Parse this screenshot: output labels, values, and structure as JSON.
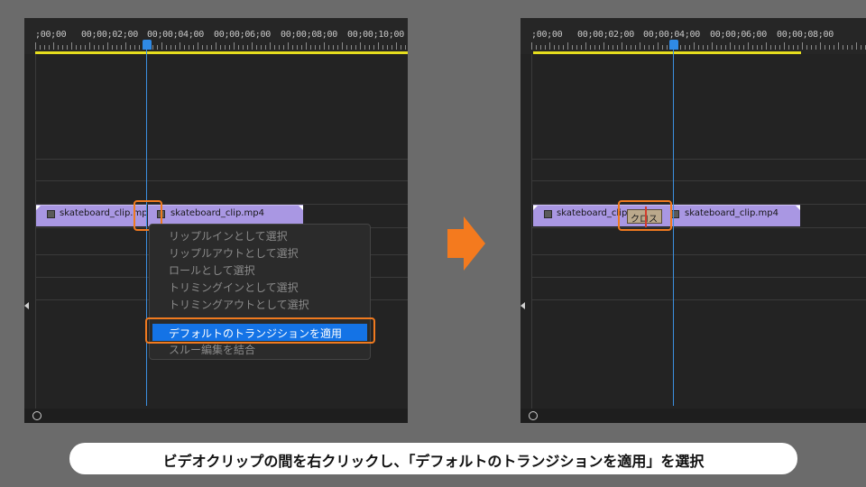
{
  "left_panel": {
    "timecodes": [
      ";00;00",
      "00;00;02;00",
      "00;00;04;00",
      "00;00;06;00",
      "00;00;08;00",
      "00;00;10;00"
    ],
    "clips": [
      {
        "label": "skateboard_clip.mp4",
        "display": "skateboard_clip.mp"
      },
      {
        "label": "skateboard_clip.mp4",
        "display": "skateboard_clip.mp4"
      }
    ],
    "context_menu": {
      "items": [
        "リップルインとして選択",
        "リップルアウトとして選択",
        "ロールとして選択",
        "トリミングインとして選択",
        "トリミングアウトとして選択"
      ],
      "selected_item": "デフォルトのトランジションを適用",
      "partial_item": "スルー編集を結合"
    }
  },
  "right_panel": {
    "timecodes": [
      ";00;00",
      "00;00;02;00",
      "00;00;04;00",
      "00;00;06;00",
      "00;00;08;00"
    ],
    "clips": [
      {
        "label": "skateboard_clip.mp4",
        "display": "skateboard_clip."
      },
      {
        "label": "skateboard_clip.mp4",
        "display": "skateboard_clip.mp4"
      }
    ],
    "transition_label": "クロス"
  },
  "colors": {
    "background": "#6b6b6b",
    "panel": "#232323",
    "clip": "#a997e3",
    "playhead": "#3b8fe0",
    "highlight": "#f07a1f",
    "menu_selected": "#1473e6",
    "workbar": "#e6de1e"
  },
  "caption": "ビデオクリップの間を右クリックし、「デフォルトのトランジションを適用」を選択",
  "icons": [
    "film-icon",
    "arrow-right-icon",
    "zoom-circle-icon",
    "collapse-arrow-icon"
  ]
}
